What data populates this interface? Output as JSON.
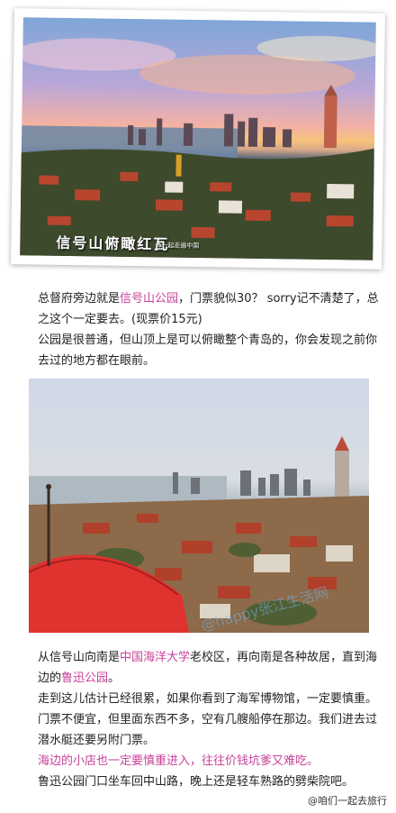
{
  "photo1": {
    "caption": "信号山俯瞰红瓦",
    "caption_sub": "@一起走遍中国"
  },
  "block1": {
    "p1_a": "总督府旁边就是",
    "p1_link": "信号山公园",
    "p1_b": "，门票貌似30？ sorry记不清楚了，总之这个一定要去。(现票价15元)",
    "p2": "公园是很普通，但山顶上是可以俯瞰整个青岛的，你会发现之前你去过的地方都在眼前。"
  },
  "photo2": {
    "watermark": "@happy张江生活网"
  },
  "block2": {
    "p1_a": "从信号山向南是",
    "p1_link1": "中国海洋大学",
    "p1_b": "老校区，再向南是各种故居，直到海边的",
    "p1_link2": "鲁迅公园",
    "p1_c": "。",
    "p2": "走到这儿估计已经很累，如果你看到了海军博物馆，一定要慎重。门票不便宜，但里面东西不多，空有几艘船停在那边。我们进去过潜水艇还要另附门票。",
    "p3": "海边的小店也一定要慎重进入，往往价钱坑爹又难吃。",
    "p4": "鲁迅公园门口坐车回中山路，晚上还是轻车熟路的劈柴院吧。"
  },
  "footer": {
    "credit": "@咱们一起去旅行"
  }
}
